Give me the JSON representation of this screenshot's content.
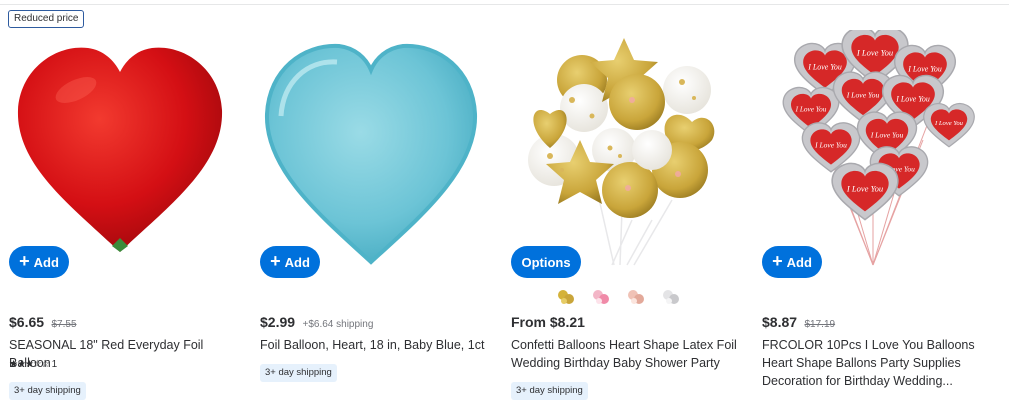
{
  "products": [
    {
      "badge": "Reduced price",
      "button": "Add",
      "price": "$6.65",
      "was_price": "$7.55",
      "title": "SEASONAL 18\" Red Everyday Foil Balloon",
      "rating_stars": "★★★☆☆",
      "review_count": "1",
      "shipping": "3+ day shipping"
    },
    {
      "button": "Add",
      "price": "$2.99",
      "shipping_fee": "+$6.64 shipping",
      "title": "Foil Balloon, Heart, 18 in, Baby Blue, 1ct",
      "shipping": "3+ day shipping"
    },
    {
      "button": "Options",
      "price": "From $8.21",
      "title": "Confetti Balloons Heart Shape Latex Foil Wedding Birthday Baby Shower Party",
      "shipping": "3+ day shipping",
      "swatches": [
        "gold",
        "pink",
        "rose-gold",
        "silver"
      ]
    },
    {
      "button": "Add",
      "price": "$8.87",
      "was_price": "$17.19",
      "title": "FRCOLOR 10Pcs I Love You Balloons Heart Shape Ballons Party Supplies Decoration for Birthday Wedding..."
    }
  ],
  "balloon_text": "I Love You",
  "colors": {
    "primary_button": "#0071dc",
    "shipping_tag_bg": "#e6f1fc",
    "red_balloon": "#d40f14",
    "blue_balloon": "#6cc4d6",
    "gold": "#c9a53a"
  }
}
